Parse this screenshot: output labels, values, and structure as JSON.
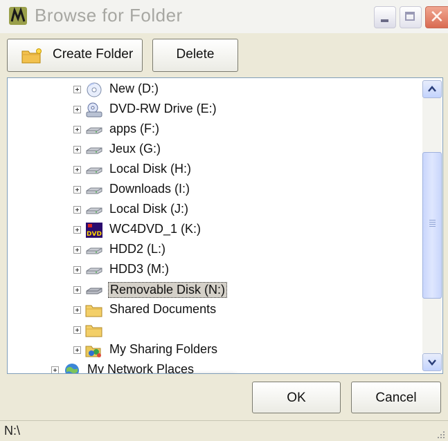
{
  "window": {
    "title": "Browse for Folder"
  },
  "toolbar": {
    "create_folder_label": "Create Folder",
    "delete_label": "Delete"
  },
  "tree": {
    "items": [
      {
        "label": "New (D:)",
        "icon": "cd-drive-icon"
      },
      {
        "label": "DVD-RW Drive (E:)",
        "icon": "dvd-drive-icon"
      },
      {
        "label": "apps (F:)",
        "icon": "hard-drive-icon"
      },
      {
        "label": "Jeux (G:)",
        "icon": "hard-drive-icon"
      },
      {
        "label": "Local Disk (H:)",
        "icon": "hard-drive-icon"
      },
      {
        "label": "Downloads (I:)",
        "icon": "hard-drive-icon"
      },
      {
        "label": "Local Disk (J:)",
        "icon": "hard-drive-icon"
      },
      {
        "label": "WC4DVD_1 (K:)",
        "icon": "dvd-media-icon"
      },
      {
        "label": "HDD2 (L:)",
        "icon": "hard-drive-icon"
      },
      {
        "label": "HDD3 (M:)",
        "icon": "hard-drive-icon"
      },
      {
        "label": "Removable Disk (N:)",
        "icon": "removable-disk-icon",
        "selected": true
      },
      {
        "label": "Shared Documents",
        "icon": "folder-icon"
      },
      {
        "label": "",
        "icon": "folder-icon",
        "redacted": true
      },
      {
        "label": "My Sharing Folders",
        "icon": "sharing-folder-icon"
      },
      {
        "label": "My Network Places",
        "icon": "network-places-icon"
      }
    ]
  },
  "buttons": {
    "ok_label": "OK",
    "cancel_label": "Cancel"
  },
  "status": {
    "path": "N:\\"
  },
  "colors": {
    "selection": "#d4d0c8",
    "dialog_bg": "#ece9d8",
    "tree_border": "#7f9db9"
  }
}
